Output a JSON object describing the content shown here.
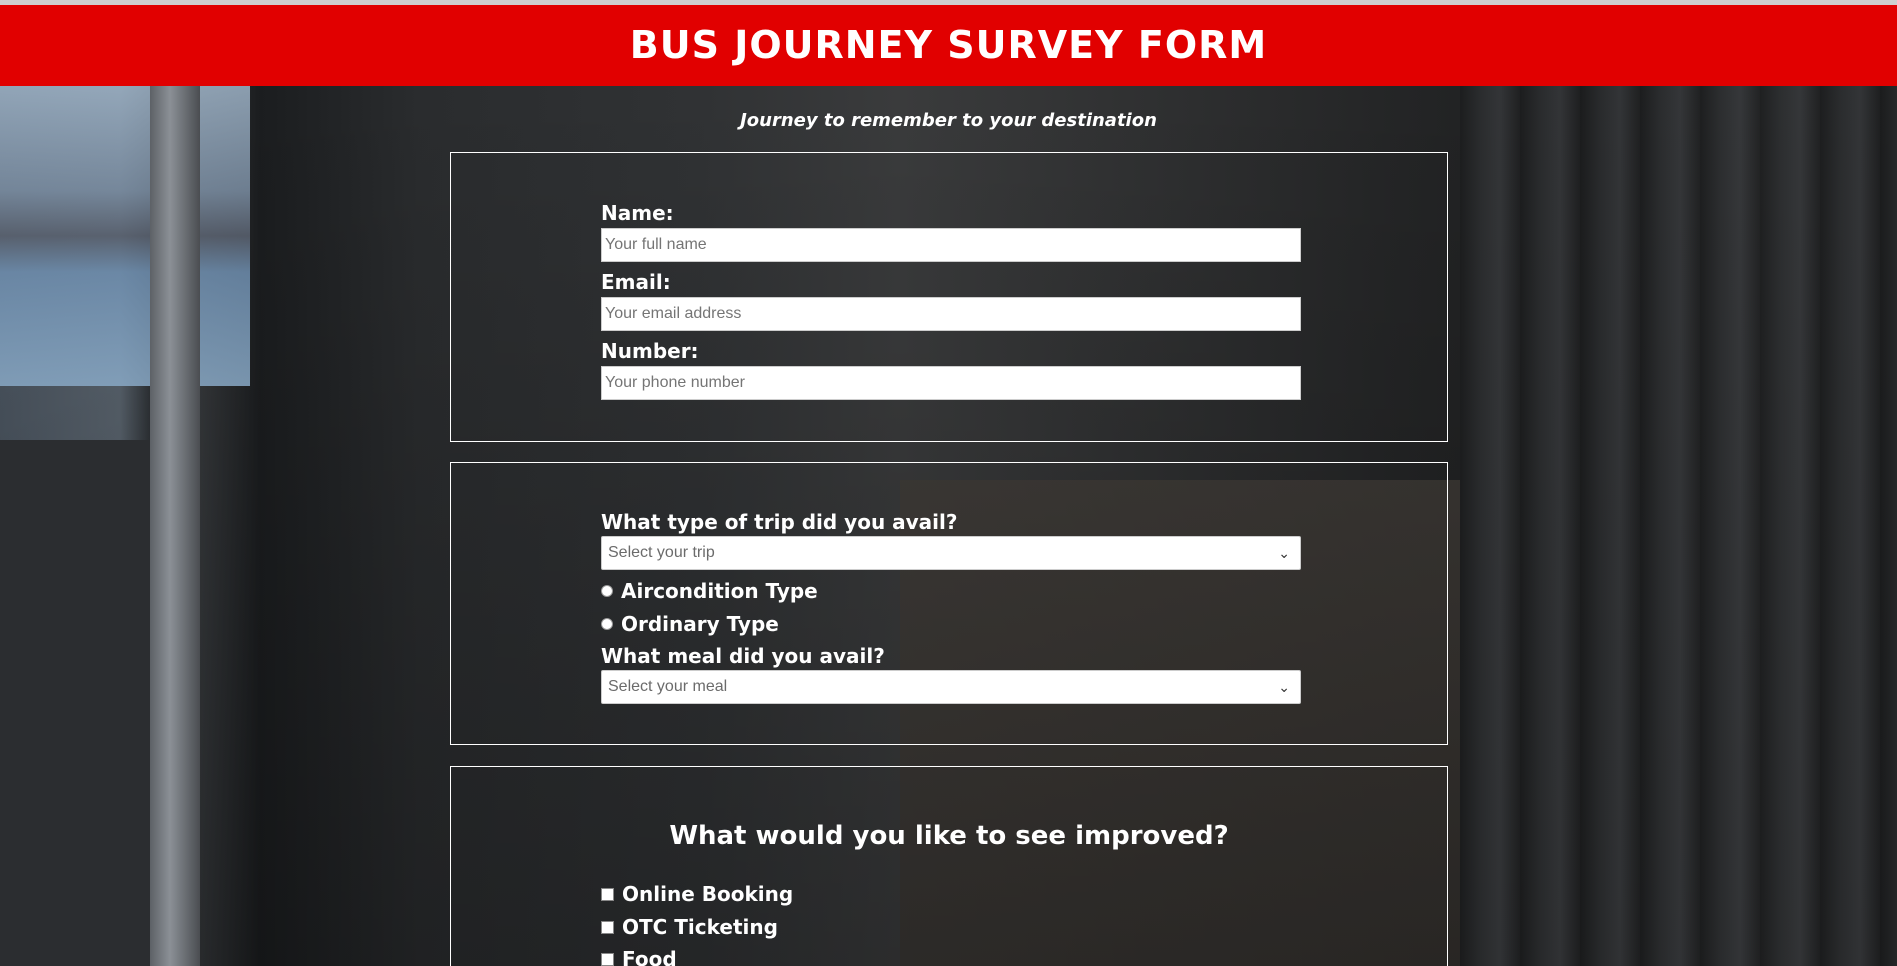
{
  "header": {
    "title": "BUS JOURNEY SURVEY FORM",
    "color": "#e10000"
  },
  "tagline": "Journey to remember to your destination",
  "contact": {
    "name_label": "Name:",
    "name_placeholder": "Your full name",
    "email_label": "Email:",
    "email_placeholder": "Your email address",
    "number_label": "Number:",
    "number_placeholder": "Your phone number"
  },
  "trip": {
    "trip_question": "What type of trip did you avail?",
    "trip_select_value": "Select your trip",
    "radio_options": [
      "Aircondition Type",
      "Ordinary Type"
    ],
    "meal_question": "What meal did you avail?",
    "meal_select_value": "Select your meal"
  },
  "improvements": {
    "heading": "What would you like to see improved?",
    "options": [
      "Online Booking",
      "OTC Ticketing",
      "Food"
    ]
  },
  "icons": {
    "select_chevron": "chevron-down-icon"
  }
}
